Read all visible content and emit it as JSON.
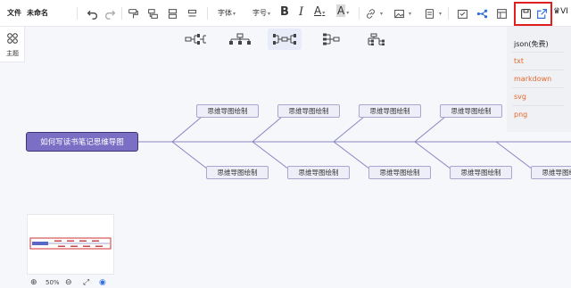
{
  "toolbar": {
    "file_label": "文件",
    "doc_title": "未命名",
    "font_label": "字体",
    "size_label": "字号",
    "bold_label": "B",
    "italic_label": "I",
    "font_color_label": "A",
    "bg_color_label": "A",
    "vip_label": "VI"
  },
  "left_panel": {
    "theme_label": "主题"
  },
  "layout_options": [
    "logic-right",
    "org-down",
    "logic-both",
    "tree-left",
    "org-tree"
  ],
  "export_menu": {
    "items": [
      "json(免费)",
      "txt",
      "markdown",
      "svg",
      "png"
    ]
  },
  "mindmap": {
    "root": "如何写读书笔记思维导图",
    "top_nodes": [
      "思维导图绘制",
      "思维导图绘制",
      "思维导图绘制",
      "思维导图绘制"
    ],
    "bottom_nodes": [
      "思维导图绘制",
      "思维导图绘制",
      "思维导图绘制",
      "思维导图绘制",
      "思维导图绘制"
    ]
  },
  "zoom": {
    "level": "50%"
  },
  "colors": {
    "accent": "#7a6fc4",
    "export_link": "#e0682e",
    "highlight": "#e02020",
    "active_blue": "#2f6fe0"
  }
}
